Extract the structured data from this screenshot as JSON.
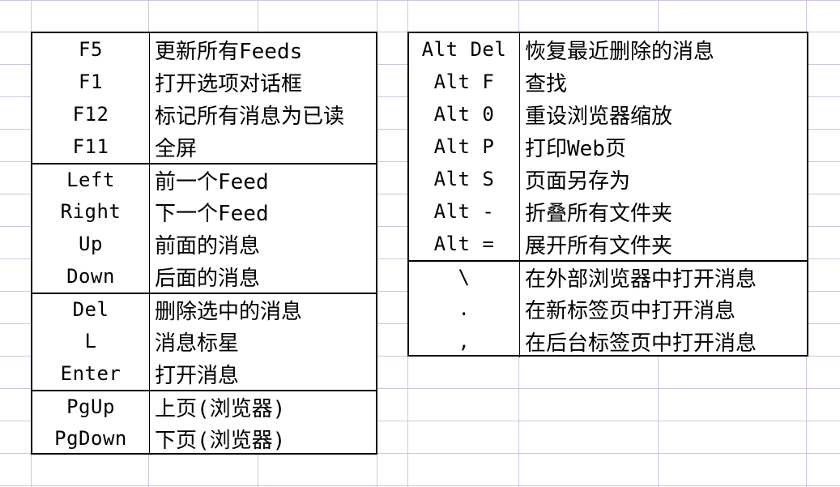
{
  "left_groups": [
    {
      "rows": [
        {
          "key": "F5",
          "desc": "更新所有Feeds"
        },
        {
          "key": "F1",
          "desc": "打开选项对话框"
        },
        {
          "key": "F12",
          "desc": "标记所有消息为已读"
        },
        {
          "key": "F11",
          "desc": "全屏"
        }
      ]
    },
    {
      "rows": [
        {
          "key": "Left",
          "desc": "前一个Feed"
        },
        {
          "key": "Right",
          "desc": "下一个Feed"
        },
        {
          "key": "Up",
          "desc": "前面的消息"
        },
        {
          "key": "Down",
          "desc": "后面的消息"
        }
      ]
    },
    {
      "rows": [
        {
          "key": "Del",
          "desc": "删除选中的消息"
        },
        {
          "key": "L",
          "desc": "消息标星"
        },
        {
          "key": "Enter",
          "desc": "打开消息"
        }
      ]
    },
    {
      "rows": [
        {
          "key": "PgUp",
          "desc": "上页(浏览器)"
        },
        {
          "key": "PgDown",
          "desc": "下页(浏览器)"
        }
      ]
    }
  ],
  "right_groups": [
    {
      "rows": [
        {
          "key": "Alt Del",
          "desc": "恢复最近删除的消息"
        },
        {
          "key": "Alt F",
          "desc": "查找"
        },
        {
          "key": "Alt 0",
          "desc": "重设浏览器缩放"
        },
        {
          "key": "Alt P",
          "desc": "打印Web页"
        },
        {
          "key": "Alt S",
          "desc": "页面另存为"
        },
        {
          "key": "Alt -",
          "desc": "折叠所有文件夹"
        },
        {
          "key": "Alt =",
          "desc": "展开所有文件夹"
        }
      ]
    },
    {
      "rows": [
        {
          "key": "\\",
          "desc": "在外部浏览器中打开消息"
        },
        {
          "key": ".",
          "desc": "在新标签页中打开消息"
        },
        {
          "key": ",",
          "desc": "在后台标签页中打开消息"
        }
      ]
    }
  ]
}
